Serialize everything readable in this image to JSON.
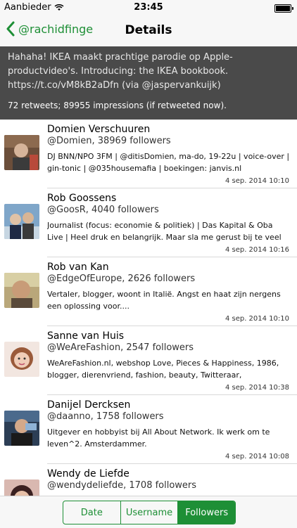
{
  "status_bar": {
    "carrier": "Aanbieder",
    "time": "23:45"
  },
  "nav": {
    "back_label": "@rachidfinge",
    "title": "Details"
  },
  "tweet": {
    "text": "Hahaha! IKEA maakt prachtige parodie op Apple-productvideo's. Introducing: the IKEA bookbook. https://t.co/vM8kB2aDfn (via @jaspervankuijk)",
    "stats": "72 retweets; 89955 impressions (if retweeted now)."
  },
  "followers": [
    {
      "name": "Domien Verschuuren",
      "handle": "@Domien, 38969 followers",
      "bio": "DJ BNN/NPO 3FM | @ditisDomien, ma-do, 19-22u | voice-over | gin-tonic | @035housemafia | boekingen: janvis.nl",
      "date": "4 sep. 2014 10:10"
    },
    {
      "name": "Rob Goossens",
      "handle": "@GoosR, 4040 followers",
      "bio": "Journalist (focus: economie & politiek) | Das Kapital & Oba Live | Heel druk en belangrijk. Maar sla me gerust bij te veel voetb...",
      "date": "4 sep. 2014 10:16"
    },
    {
      "name": "Rob van Kan",
      "handle": "@EdgeOfEurope, 2626 followers",
      "bio": "Vertaler, blogger, woont in Italië. Angst en haat zijn nergens een oplossing voor....",
      "date": "4 sep. 2014 10:10"
    },
    {
      "name": "Sanne van Huis",
      "handle": "@WeAreFashion, 2547 followers",
      "bio": "WeAreFashion.nl, webshop Love, Pieces & Happiness, 1986, blogger, dierenvriend, fashion, beauty, Twitteraar, Groninger,...",
      "date": "4 sep. 2014 10:38"
    },
    {
      "name": "Danijel Dercksen",
      "handle": "@daanno, 1758 followers",
      "bio": "Uitgever en hobbyist bij All About Network. Ik werk om te leven^2. Amsterdammer.",
      "date": "4 sep. 2014 10:08"
    },
    {
      "name": "Wendy de Liefde",
      "handle": "@wendydeliefde, 1708 followers",
      "bio": "",
      "date": ""
    }
  ],
  "sort_tabs": [
    {
      "label": "Date",
      "active": false
    },
    {
      "label": "Username",
      "active": false
    },
    {
      "label": "Followers",
      "active": true
    }
  ],
  "colors": {
    "accent": "#1e8f36",
    "header_bg": "#4a4a4a"
  }
}
